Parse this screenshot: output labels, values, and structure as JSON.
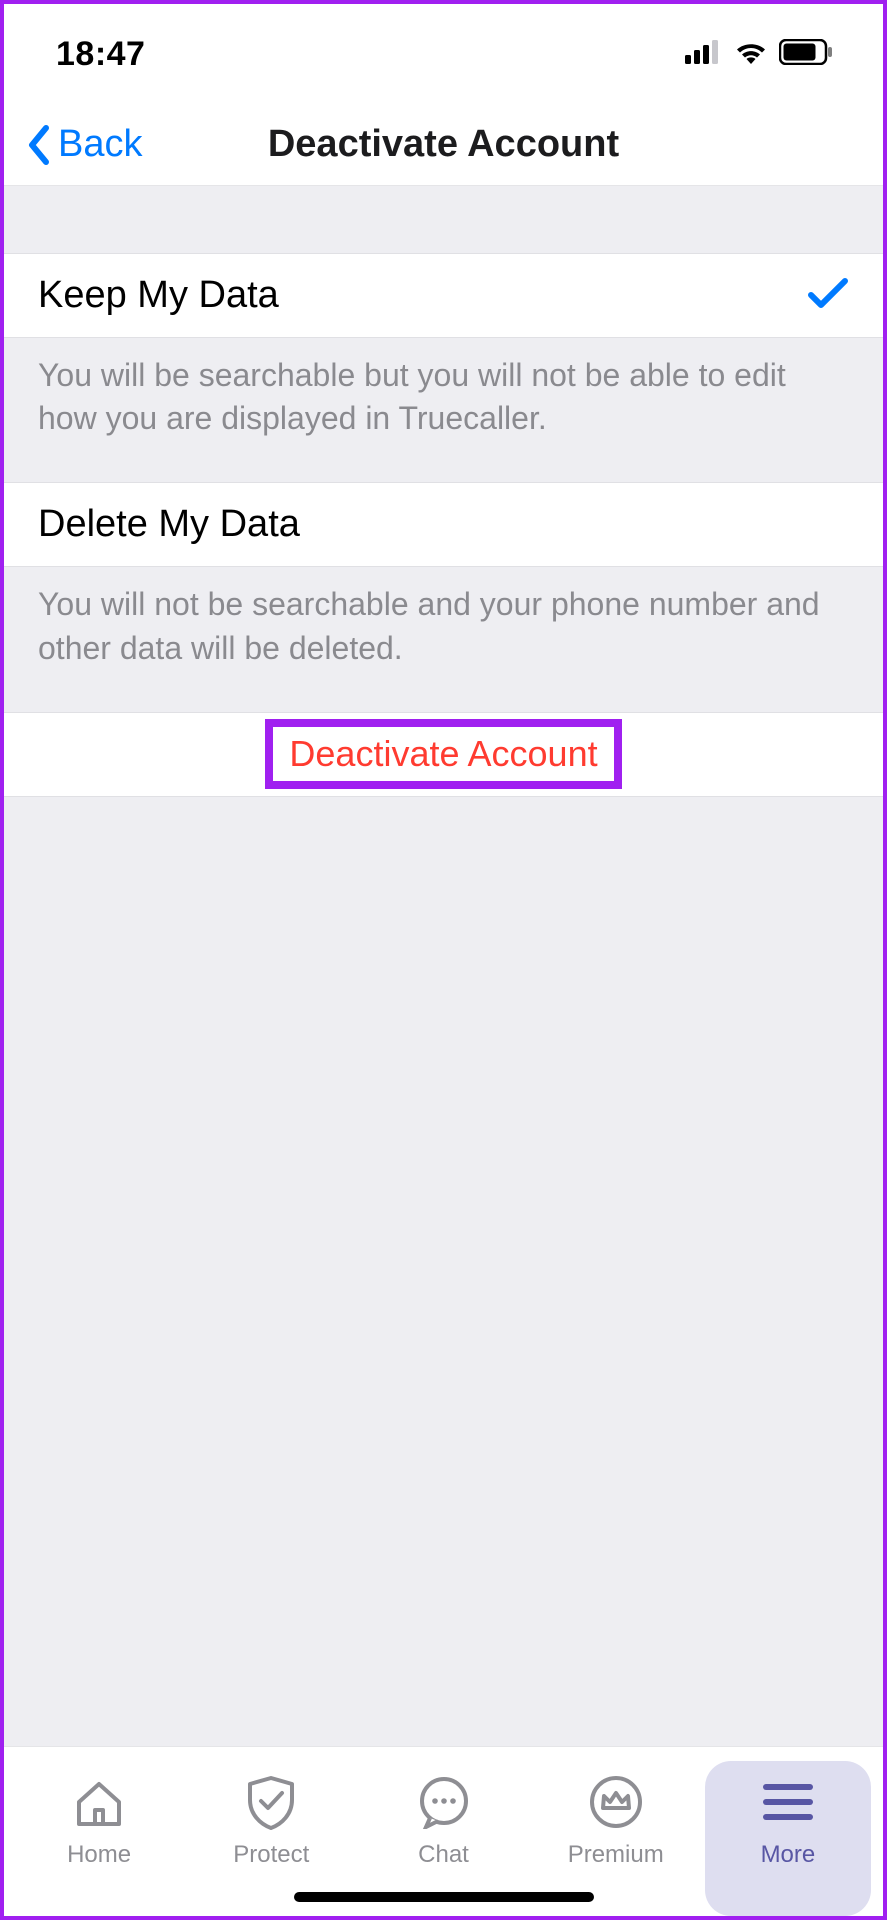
{
  "status": {
    "time": "18:47"
  },
  "nav": {
    "back": "Back",
    "title": "Deactivate Account"
  },
  "options": {
    "keep": {
      "label": "Keep My Data",
      "selected": true,
      "desc": "You will be searchable but you will not be able to edit how you are displayed in Truecaller."
    },
    "delete": {
      "label": "Delete My Data",
      "selected": false,
      "desc": "You will not be searchable and your phone number and other data will be deleted."
    }
  },
  "action": {
    "label": "Deactivate Account"
  },
  "tabs": {
    "home": "Home",
    "protect": "Protect",
    "chat": "Chat",
    "premium": "Premium",
    "more": "More"
  }
}
